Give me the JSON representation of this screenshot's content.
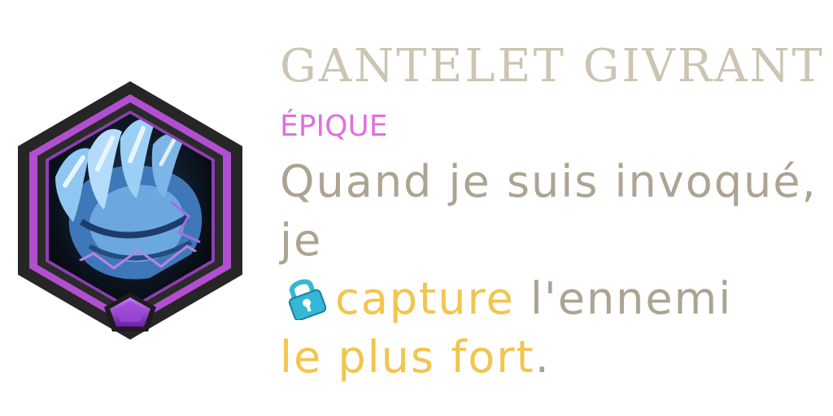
{
  "card": {
    "name": "GANTELET GIVRANT",
    "rarity": "ÉPIQUE",
    "description": {
      "part1": "Quand je suis invoqué, je",
      "keyword_icon": "lock-icon",
      "keyword1": "capture",
      "part2": " l'ennemi",
      "keyword2": "le plus fort",
      "end": "."
    }
  },
  "colors": {
    "title": "#ccc5b3",
    "rarity": "#e070e0",
    "text": "#aca492",
    "keyword": "#f2c54e",
    "frame": "#2a2a2a",
    "frame_accent": "#b14fd0",
    "gem": "#8a2fc4",
    "lock": "#35b7d6"
  },
  "icons": {
    "item": "frost-gauntlet-icon",
    "gem": "pentagon-gem-icon",
    "keyword": "lock-icon"
  }
}
